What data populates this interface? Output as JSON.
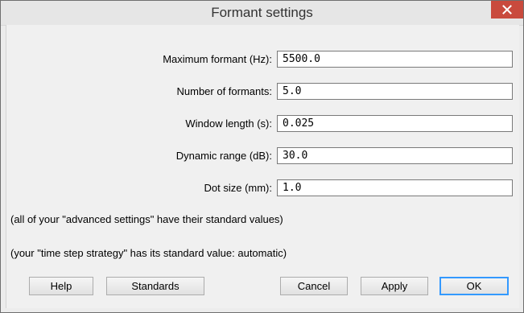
{
  "window": {
    "title": "Formant settings",
    "close_icon": "close-icon"
  },
  "fields": [
    {
      "label": "Maximum formant (Hz):",
      "value": "5500.0"
    },
    {
      "label": "Number of formants:",
      "value": "5.0"
    },
    {
      "label": "Window length (s):",
      "value": "0.025"
    },
    {
      "label": "Dynamic range (dB):",
      "value": "30.0"
    },
    {
      "label": "Dot size (mm):",
      "value": "1.0"
    }
  ],
  "notes": {
    "advanced": "(all of your \"advanced settings\" have their standard values)",
    "time_step": "(your \"time step strategy\" has its standard value: automatic)"
  },
  "buttons": {
    "help": "Help",
    "standards": "Standards",
    "cancel": "Cancel",
    "apply": "Apply",
    "ok": "OK"
  },
  "colors": {
    "close_button": "#c94a3d",
    "default_button_border": "#3399ff"
  }
}
